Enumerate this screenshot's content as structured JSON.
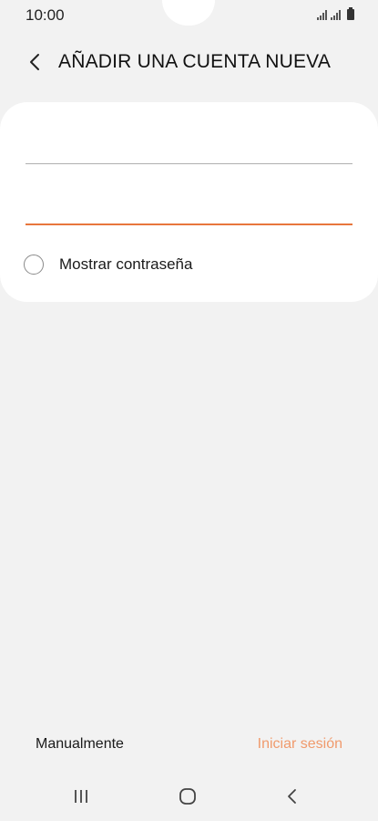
{
  "status_bar": {
    "time": "10:00",
    "icons": [
      "signal-icon",
      "signal-icon",
      "battery-icon"
    ]
  },
  "header": {
    "back_icon": "back-arrow-icon",
    "title": "AÑADIR UNA CUENTA NUEVA"
  },
  "form": {
    "email_field": {
      "value": "",
      "placeholder": ""
    },
    "password_field": {
      "value": "",
      "placeholder": ""
    },
    "show_password": {
      "label": "Mostrar contraseña",
      "checked": false
    }
  },
  "actions": {
    "manual_label": "Manualmente",
    "login_label": "Iniciar sesión"
  },
  "nav_bar": {
    "icons": [
      "recent-apps-icon",
      "home-icon",
      "back-icon"
    ]
  },
  "colors": {
    "accent": "#e8763d",
    "login_text": "#f09a6c",
    "background": "#f2f2f2",
    "card": "#ffffff"
  }
}
